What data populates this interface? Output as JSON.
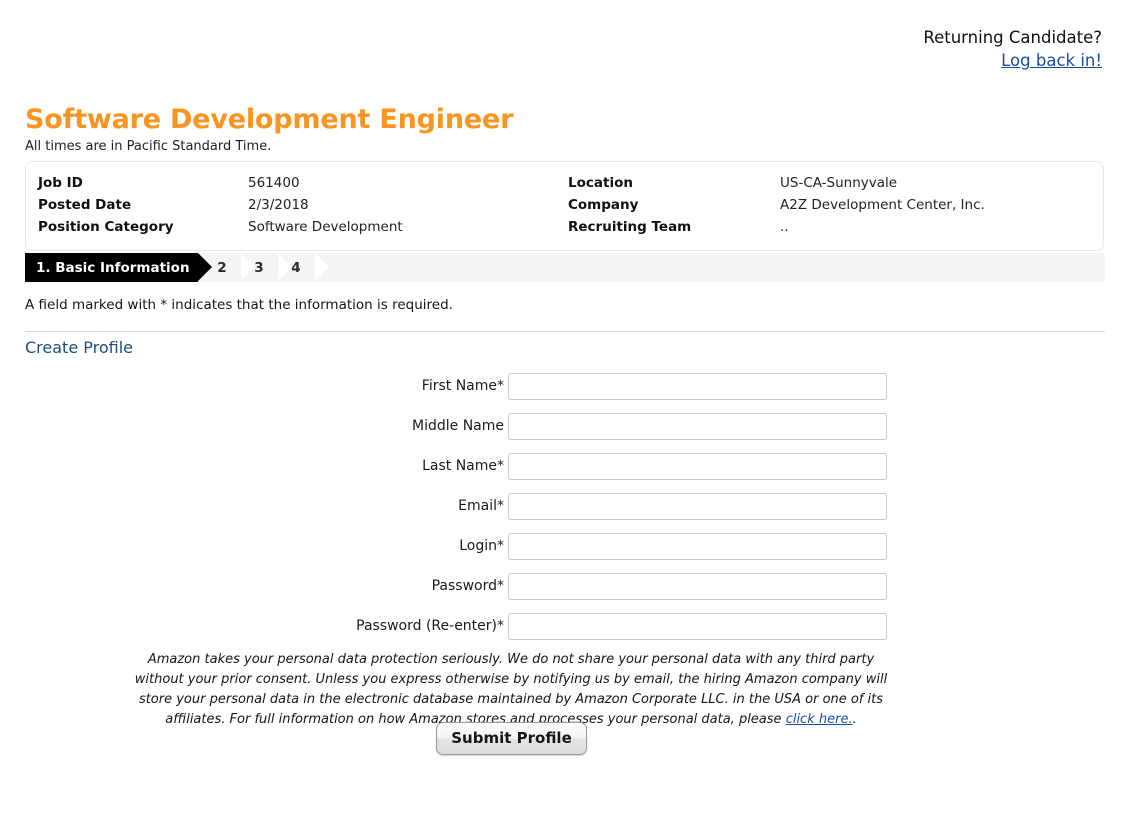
{
  "returning": {
    "prompt": "Returning Candidate?",
    "login_link": "Log back in!"
  },
  "job": {
    "title": "Software Development Engineer",
    "timezone_note": "All times are in Pacific Standard Time.",
    "fields": [
      {
        "key": "Job ID",
        "value": "561400"
      },
      {
        "key": "Posted Date",
        "value": "2/3/2018"
      },
      {
        "key": "Position Category",
        "value": "Software Development"
      },
      {
        "key": "Location",
        "value": "US-CA-Sunnyvale"
      },
      {
        "key": "Company",
        "value": "A2Z Development Center, Inc."
      },
      {
        "key": "Recruiting Team",
        "value": ".."
      }
    ]
  },
  "steps": {
    "active_label": "1. Basic Information",
    "others": [
      "2",
      "3",
      "4"
    ]
  },
  "notes": {
    "required": "A field marked with * indicates that the information is required."
  },
  "section": {
    "title": "Create Profile"
  },
  "form": {
    "fields": [
      {
        "label": "First Name*",
        "value": "",
        "placeholder": ""
      },
      {
        "label": "Middle Name",
        "value": "",
        "placeholder": ""
      },
      {
        "label": "Last Name*",
        "value": "",
        "placeholder": ""
      },
      {
        "label": "Email*",
        "value": "",
        "placeholder": ""
      },
      {
        "label": "Login*",
        "value": "",
        "placeholder": ""
      },
      {
        "label": "Password*",
        "value": "",
        "placeholder": ""
      },
      {
        "label": "Password (Re-enter)*",
        "value": "",
        "placeholder": ""
      }
    ]
  },
  "disclaimer": {
    "text_before": "Amazon takes your personal data protection seriously. We do not share your personal data with any third party without your prior consent. Unless you express otherwise by notifying us by email, the hiring Amazon company will store your personal data in the electronic database maintained by Amazon Corporate LLC. in the USA or one of its affiliates. For full information on how Amazon stores and processes your personal data, please ",
    "link_text": "click here.",
    "text_after": "."
  },
  "submit": {
    "label": "Submit Profile"
  },
  "colors": {
    "accent_orange": "#f79520",
    "link_blue": "#1a4f9c",
    "section_blue": "#1f4e79",
    "step_active_bg": "#000000",
    "step_bar_bg": "#f5f5f5"
  }
}
